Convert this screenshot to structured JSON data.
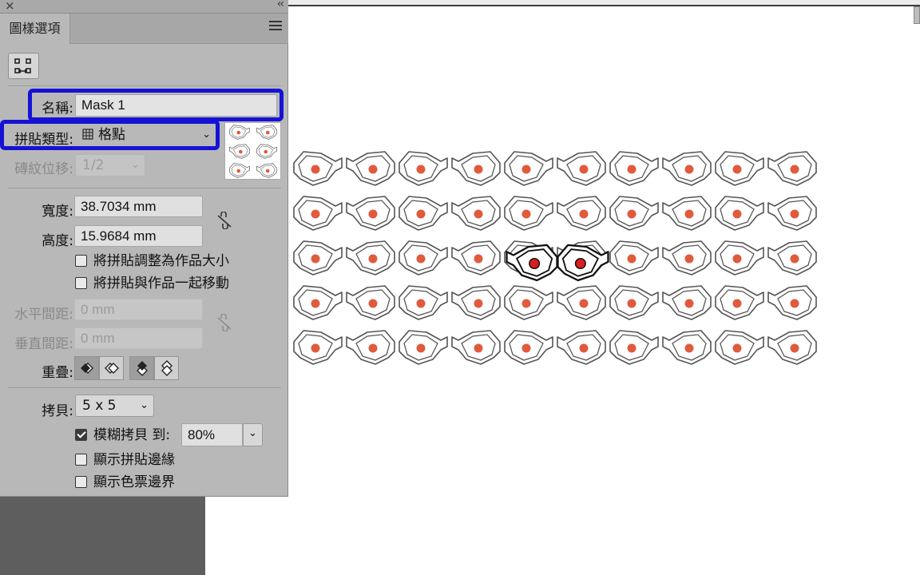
{
  "panel": {
    "tab_label": "圖樣選項",
    "close_glyph": "×",
    "collapse_glyph": "‹‹",
    "name_label": "名稱:",
    "name_value": "Mask 1",
    "tile_type_label": "拼貼類型:",
    "tile_type_value": "格點",
    "brick_offset_label": "磚紋位移:",
    "brick_offset_value": "1/2",
    "width_label": "寬度:",
    "width_value": "38.7034 mm",
    "height_label": "高度:",
    "height_value": "15.9684 mm",
    "size_tile_to_art": "將拼貼調整為作品大小",
    "move_tile_with_art": "將拼貼與作品一起移動",
    "h_spacing_label": "水平間距:",
    "h_spacing_value": "0 mm",
    "v_spacing_label": "垂直間距:",
    "v_spacing_value": "0 mm",
    "overlap_label": "重疊:",
    "copies_label": "拷貝:",
    "copies_value": "5 x 5",
    "dim_copies_label": "模糊拷貝 到:",
    "dim_copies_value": "80%",
    "show_tile_edge": "顯示拼貼邊緣",
    "show_swatch_bounds": "顯示色票邊界"
  },
  "checkboxes": {
    "size_tile_to_art": false,
    "move_tile_with_art": false,
    "dim_copies": true,
    "show_tile_edge": false,
    "show_swatch_bounds": false
  },
  "colors": {
    "highlight": "#1512d6",
    "mask_dot": "#e05a3c",
    "mask_dot_selected": "#d81e1e"
  },
  "canvas": {
    "pattern_rows": 5,
    "pattern_pairs_per_row": 5,
    "selected_row": 2,
    "selected_pair": 1
  }
}
